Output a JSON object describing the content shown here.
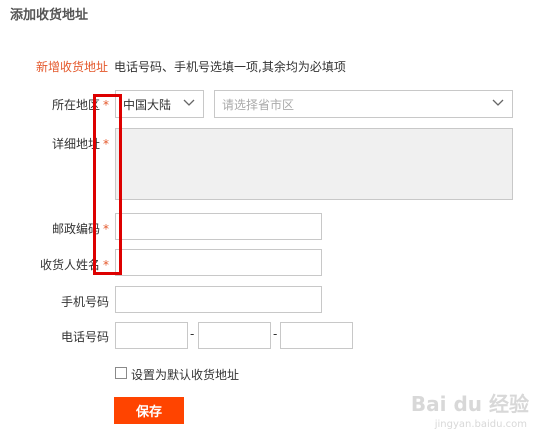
{
  "page_title": "添加收货地址",
  "subtitle": {
    "label": "新增收货地址",
    "note": "电话号码、手机号选填一项,其余均为必填项"
  },
  "form": {
    "region": {
      "label": "所在地区",
      "required_mark": "*",
      "country_value": "中国大陆",
      "province_placeholder": "请选择省市区"
    },
    "address": {
      "label": "详细地址",
      "required_mark": "*"
    },
    "postcode": {
      "label": "邮政编码",
      "required_mark": "*",
      "value": ""
    },
    "recipient": {
      "label": "收货人姓名",
      "required_mark": "*",
      "value": ""
    },
    "mobile": {
      "label": "手机号码",
      "value": ""
    },
    "phone": {
      "label": "电话号码",
      "separator1": "-",
      "separator2": "-"
    },
    "default_checkbox": {
      "label": "设置为默认收货地址",
      "checked": false
    },
    "save_label": "保存"
  },
  "watermark": {
    "main": "Bai du 经验",
    "sub": "jingyan.baidu.com"
  },
  "colors": {
    "accent": "#ff4400",
    "required": "#e4582b",
    "highlight_box": "#dd0000",
    "textarea_bg": "#f0f0f0"
  },
  "icons": [
    "chevron-down-icon",
    "checkbox-icon"
  ]
}
